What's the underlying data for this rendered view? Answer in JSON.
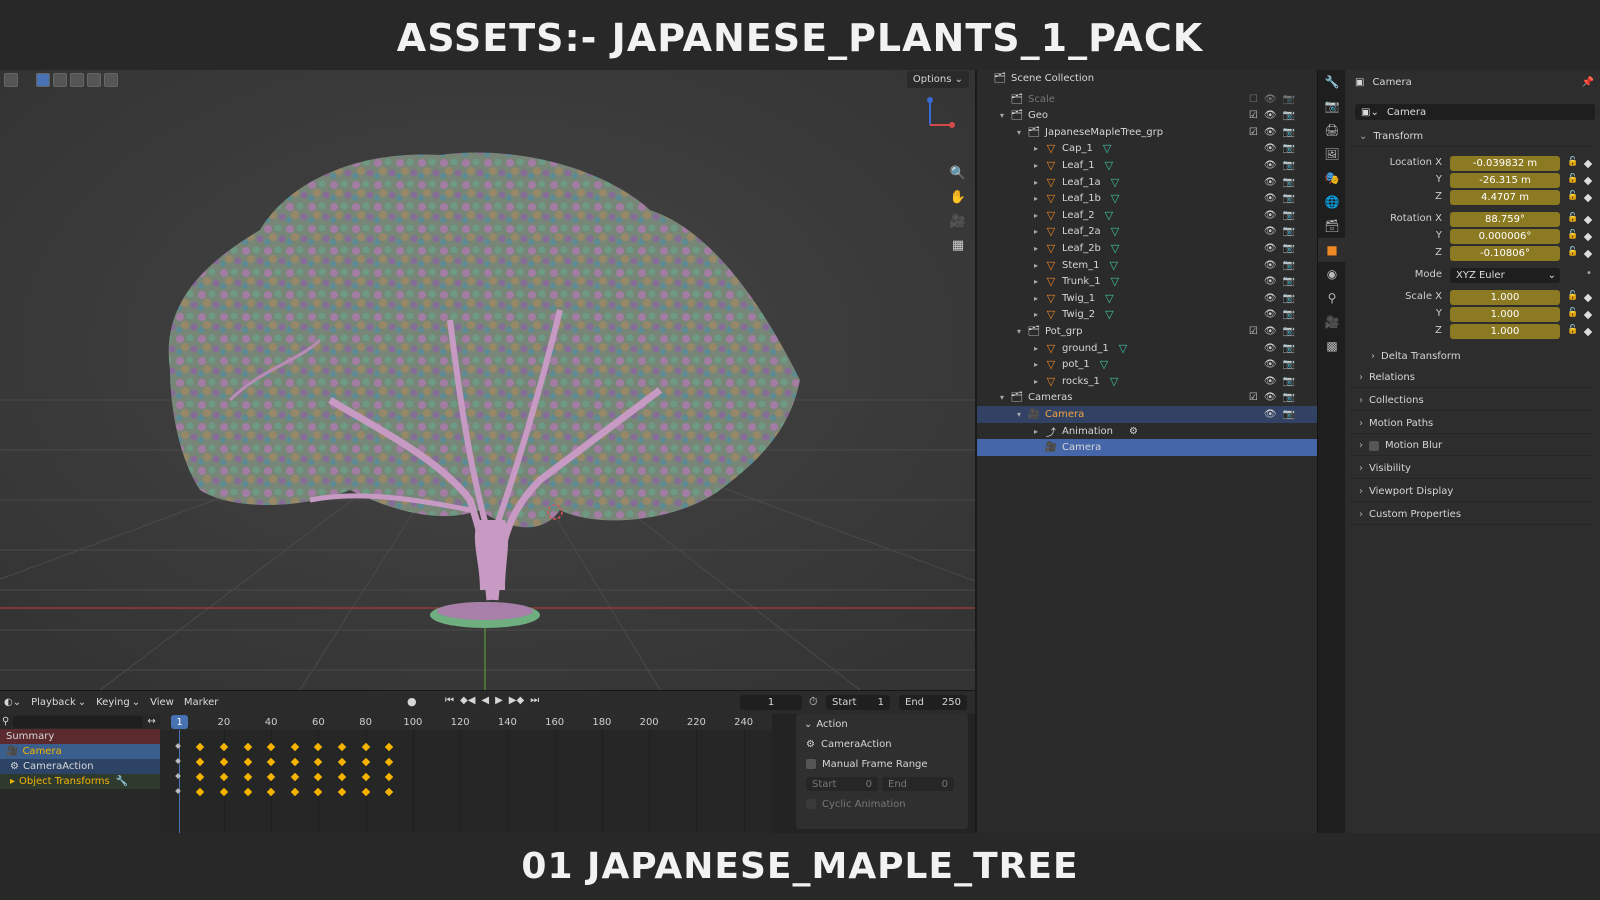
{
  "banner": {
    "top": "ASSETS:- JAPANESE_PLANTS_1_PACK",
    "bottom": "01 JAPANESE_MAPLE_TREE"
  },
  "viewport": {
    "options_label": "Options"
  },
  "timeline": {
    "menus": [
      "Playback",
      "Keying",
      "View",
      "Marker"
    ],
    "current_frame": "1",
    "start_label": "Start",
    "start_value": "1",
    "end_label": "End",
    "end_value": "250",
    "frame_numbers": [
      "1",
      "20",
      "40",
      "60",
      "80",
      "100",
      "120",
      "140",
      "160",
      "180",
      "200",
      "220",
      "240"
    ],
    "channels": [
      "Summary",
      "Camera",
      "CameraAction",
      "Object Transforms"
    ],
    "action": {
      "header": "Action",
      "name": "CameraAction",
      "manual_range": "Manual Frame Range",
      "start_label": "Start",
      "start_value": "0",
      "end_label": "End",
      "end_value": "0",
      "cyclic": "Cyclic Animation"
    }
  },
  "outliner": {
    "items": [
      {
        "label": "Scene Collection"
      },
      {
        "label": "Scale"
      },
      {
        "label": "Geo"
      },
      {
        "label": "JapaneseMapleTree_grp"
      },
      {
        "label": "Cap_1"
      },
      {
        "label": "Leaf_1"
      },
      {
        "label": "Leaf_1a"
      },
      {
        "label": "Leaf_1b"
      },
      {
        "label": "Leaf_2"
      },
      {
        "label": "Leaf_2a"
      },
      {
        "label": "Leaf_2b"
      },
      {
        "label": "Stem_1"
      },
      {
        "label": "Trunk_1"
      },
      {
        "label": "Twig_1"
      },
      {
        "label": "Twig_2"
      },
      {
        "label": "Pot_grp"
      },
      {
        "label": "ground_1"
      },
      {
        "label": "pot_1"
      },
      {
        "label": "rocks_1"
      },
      {
        "label": "Cameras"
      },
      {
        "label": "Camera"
      },
      {
        "label": "Animation"
      },
      {
        "label": "Camera"
      }
    ]
  },
  "properties": {
    "object_name": "Camera",
    "data_name": "Camera",
    "transform_label": "Transform",
    "location_x_label": "Location X",
    "location_x": "-0.039832 m",
    "location_y_label": "Y",
    "location_y": "-26.315 m",
    "location_z_label": "Z",
    "location_z": "4.4707 m",
    "rotation_x_label": "Rotation X",
    "rotation_x": "88.759°",
    "rotation_y_label": "Y",
    "rotation_y": "0.000006°",
    "rotation_z_label": "Z",
    "rotation_z": "-0.10806°",
    "mode_label": "Mode",
    "mode_value": "XYZ Euler",
    "scale_x_label": "Scale X",
    "scale_x": "1.000",
    "scale_y_label": "Y",
    "scale_y": "1.000",
    "scale_z_label": "Z",
    "scale_z": "1.000",
    "delta_transform": "Delta Transform",
    "sections": [
      "Relations",
      "Collections",
      "Motion Paths",
      "Motion Blur",
      "Visibility",
      "Viewport Display",
      "Custom Properties"
    ]
  }
}
